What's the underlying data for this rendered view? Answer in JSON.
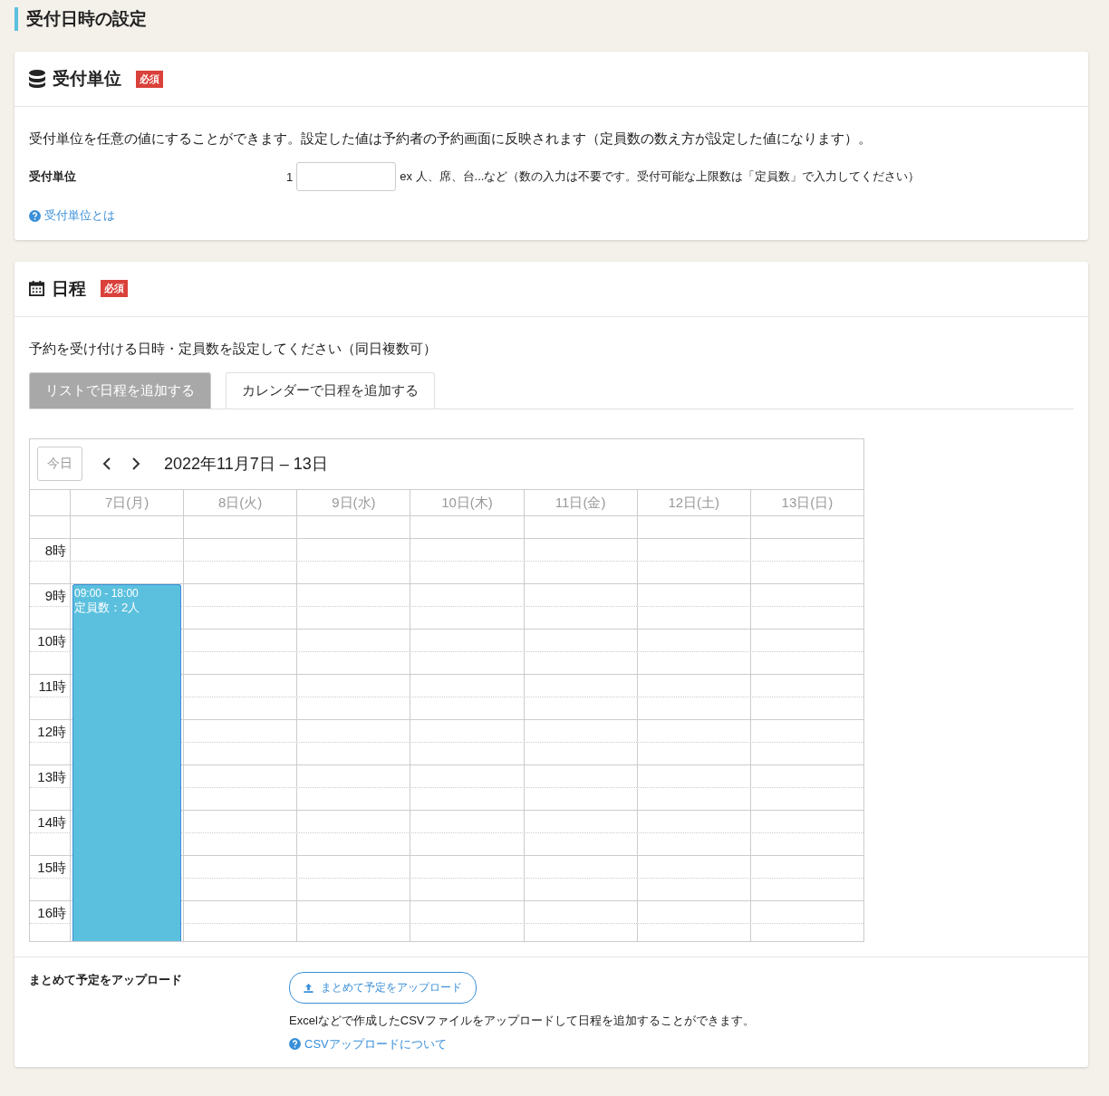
{
  "page_title": "受付日時の設定",
  "unit_section": {
    "title": "受付単位",
    "required_badge": "必須",
    "description": "受付単位を任意の値にすることができます。設定した値は予約者の予約画面に反映されます（定員数の数え方が設定した値になります）。",
    "field_label": "受付単位",
    "field_prefix": "1",
    "field_hint": "ex 人、席、台...など（数の入力は不要です。受付可能な上限数は「定員数」で入力してください）",
    "help_link": "受付単位とは"
  },
  "schedule_section": {
    "title": "日程",
    "required_badge": "必須",
    "description": "予約を受け付ける日時・定員数を設定してください（同日複数可）",
    "tabs": [
      {
        "label": "リストで日程を追加する",
        "selected": false
      },
      {
        "label": "カレンダーで日程を追加する",
        "selected": true
      }
    ],
    "calendar": {
      "today_button": "今日",
      "range_title": "2022年11月7日 – 13日",
      "days": [
        {
          "label": "7日(月)",
          "events": [
            {
              "time": "09:00 - 18:00",
              "capacity": "定員数：2人"
            }
          ]
        },
        {
          "label": "8日(火)"
        },
        {
          "label": "9日(水)"
        },
        {
          "label": "10日(木)"
        },
        {
          "label": "11日(金)"
        },
        {
          "label": "12日(土)"
        },
        {
          "label": "13日(日)"
        }
      ],
      "hours": [
        "8時",
        "9時",
        "10時",
        "11時",
        "12時",
        "13時",
        "14時",
        "15時",
        "16時"
      ]
    },
    "upload": {
      "label": "まとめて予定をアップロード",
      "button": "まとめて予定をアップロード",
      "description": "Excelなどで作成したCSVファイルをアップロードして日程を追加することができます。",
      "help_link": "CSVアップロードについて"
    }
  }
}
